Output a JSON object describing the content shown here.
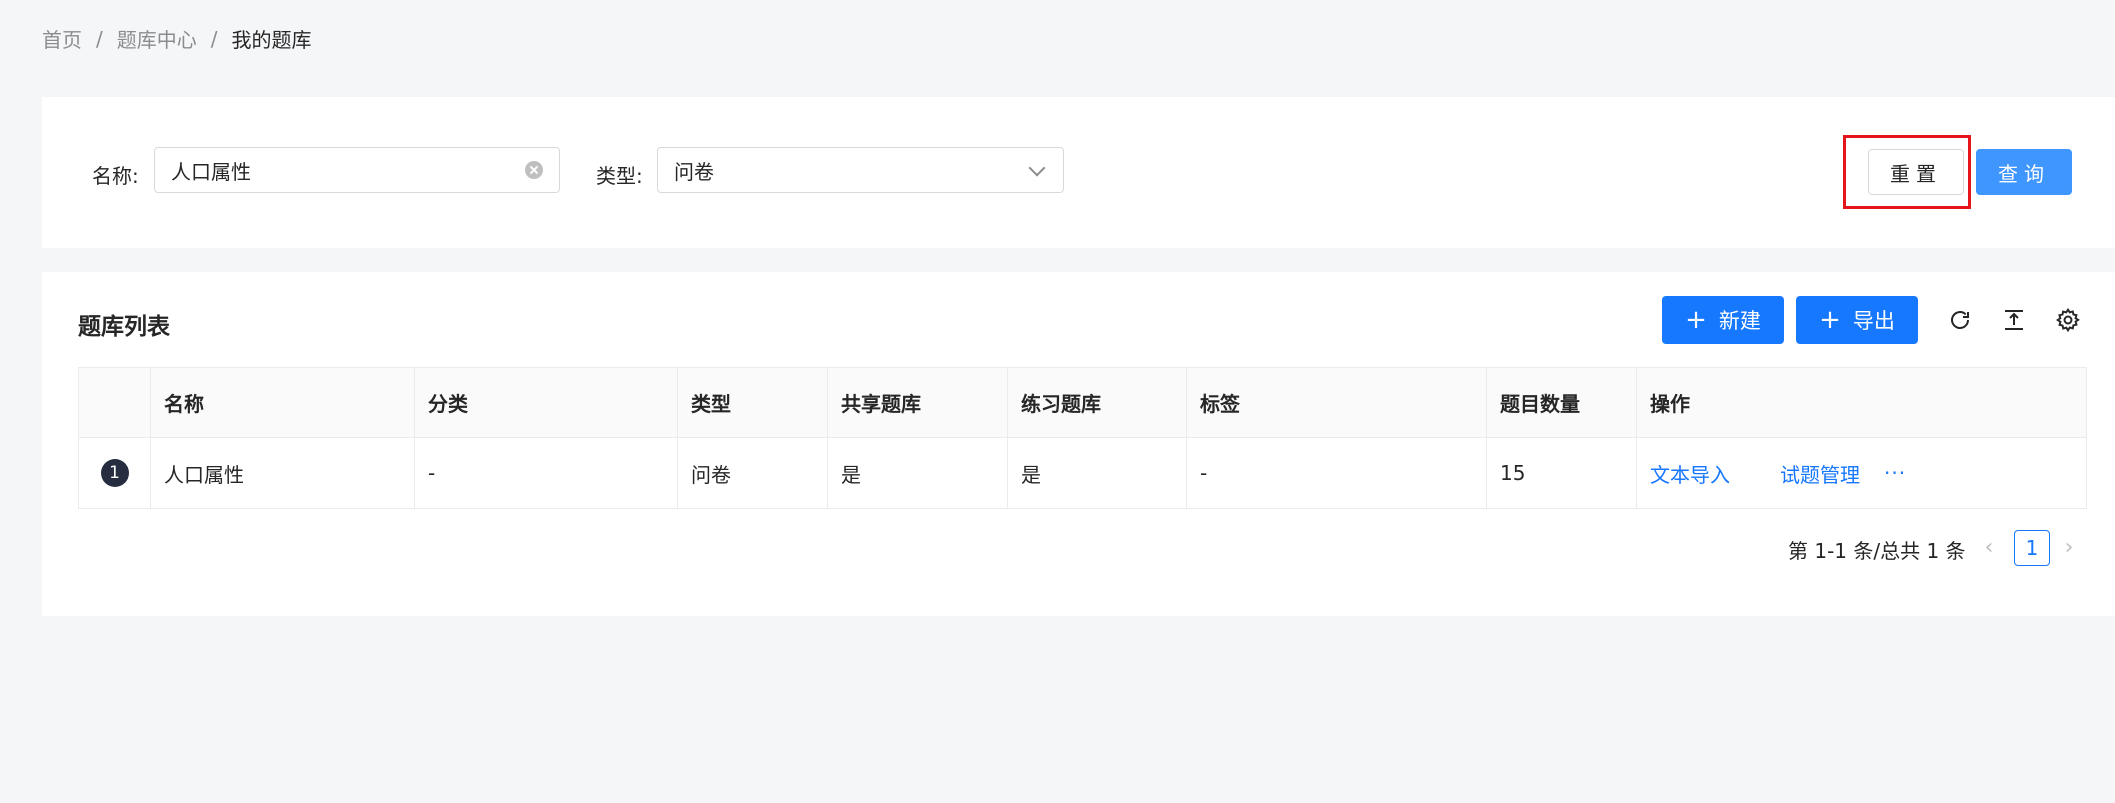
{
  "breadcrumb": {
    "items": [
      "首页",
      "题库中心",
      "我的题库"
    ],
    "separator": "/"
  },
  "search": {
    "name_label": "名称:",
    "name_value": "人口属性",
    "type_label": "类型:",
    "type_value": "问卷",
    "reset_label": "重置",
    "query_label": "查询"
  },
  "list": {
    "title": "题库列表",
    "new_label": "新建",
    "export_label": "导出",
    "icons": {
      "refresh": "refresh-icon",
      "density": "column-height-icon",
      "settings": "gear-icon"
    },
    "columns": [
      "名称",
      "分类",
      "类型",
      "共享题库",
      "练习题库",
      "标签",
      "题目数量",
      "操作"
    ],
    "rows": [
      {
        "index": "1",
        "name": "人口属性",
        "category": "-",
        "type": "问卷",
        "shared": "是",
        "practice": "是",
        "tags": "-",
        "count": "15",
        "actions": [
          "文本导入",
          "试题管理"
        ],
        "more": "···"
      }
    ]
  },
  "pagination": {
    "total_text": "第 1-1 条/总共 1 条",
    "current_page": "1",
    "prev": "‹",
    "next": "›"
  },
  "colors": {
    "primary": "#1677ff",
    "query_button": "#4096ff",
    "highlight": "#e5141b"
  }
}
